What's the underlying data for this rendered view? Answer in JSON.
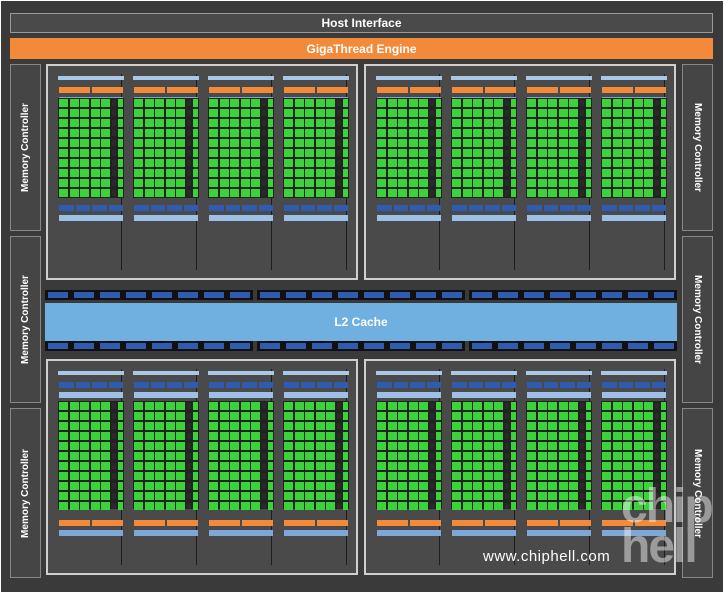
{
  "host_interface": "Host Interface",
  "gigathread_engine": "GigaThread Engine",
  "memory_controller": "Memory Controller",
  "l2_cache": "L2 Cache",
  "watermark": "www.chiphell.com",
  "logo": "chiphell",
  "colors": {
    "background": "#3a3a3a",
    "orange": "#f28a3a",
    "cuda_core": "#3ad33a",
    "register_blue": "#2f5bb0",
    "l2_blue": "#6fb0e0"
  }
}
